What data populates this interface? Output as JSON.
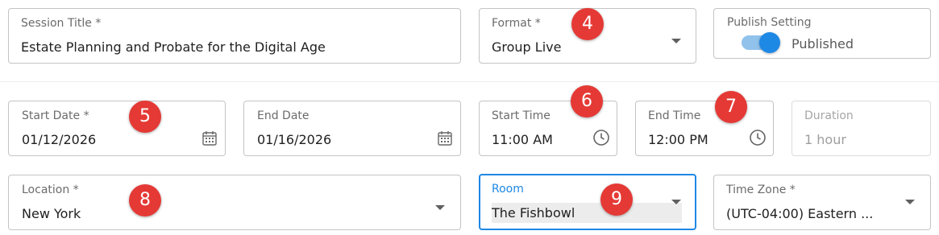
{
  "session_title": {
    "label": "Session Title *",
    "value": "Estate Planning and Probate for the Digital Age"
  },
  "format": {
    "label": "Format *",
    "value": "Group Live"
  },
  "publish_setting": {
    "label": "Publish Setting",
    "toggle_label": "Published",
    "on": true
  },
  "start_date": {
    "label": "Start Date *",
    "value": "01/12/2026"
  },
  "end_date": {
    "label": "End Date",
    "value": "01/16/2026"
  },
  "start_time": {
    "label": "Start Time",
    "value": "11:00 AM"
  },
  "end_time": {
    "label": "End Time",
    "value": "12:00 PM"
  },
  "duration": {
    "label": "Duration",
    "value": "1 hour"
  },
  "location": {
    "label": "Location *",
    "value": "New York"
  },
  "room": {
    "label": "Room",
    "value": "The Fishbowl"
  },
  "time_zone": {
    "label": "Time Zone  *",
    "value": "(UTC-04:00) Eastern ..."
  },
  "badges": [
    "4",
    "5",
    "6",
    "7",
    "8",
    "9"
  ],
  "colors": {
    "accent": "#1e88e5",
    "badge": "#e53935",
    "border": "#c4c4c4"
  }
}
